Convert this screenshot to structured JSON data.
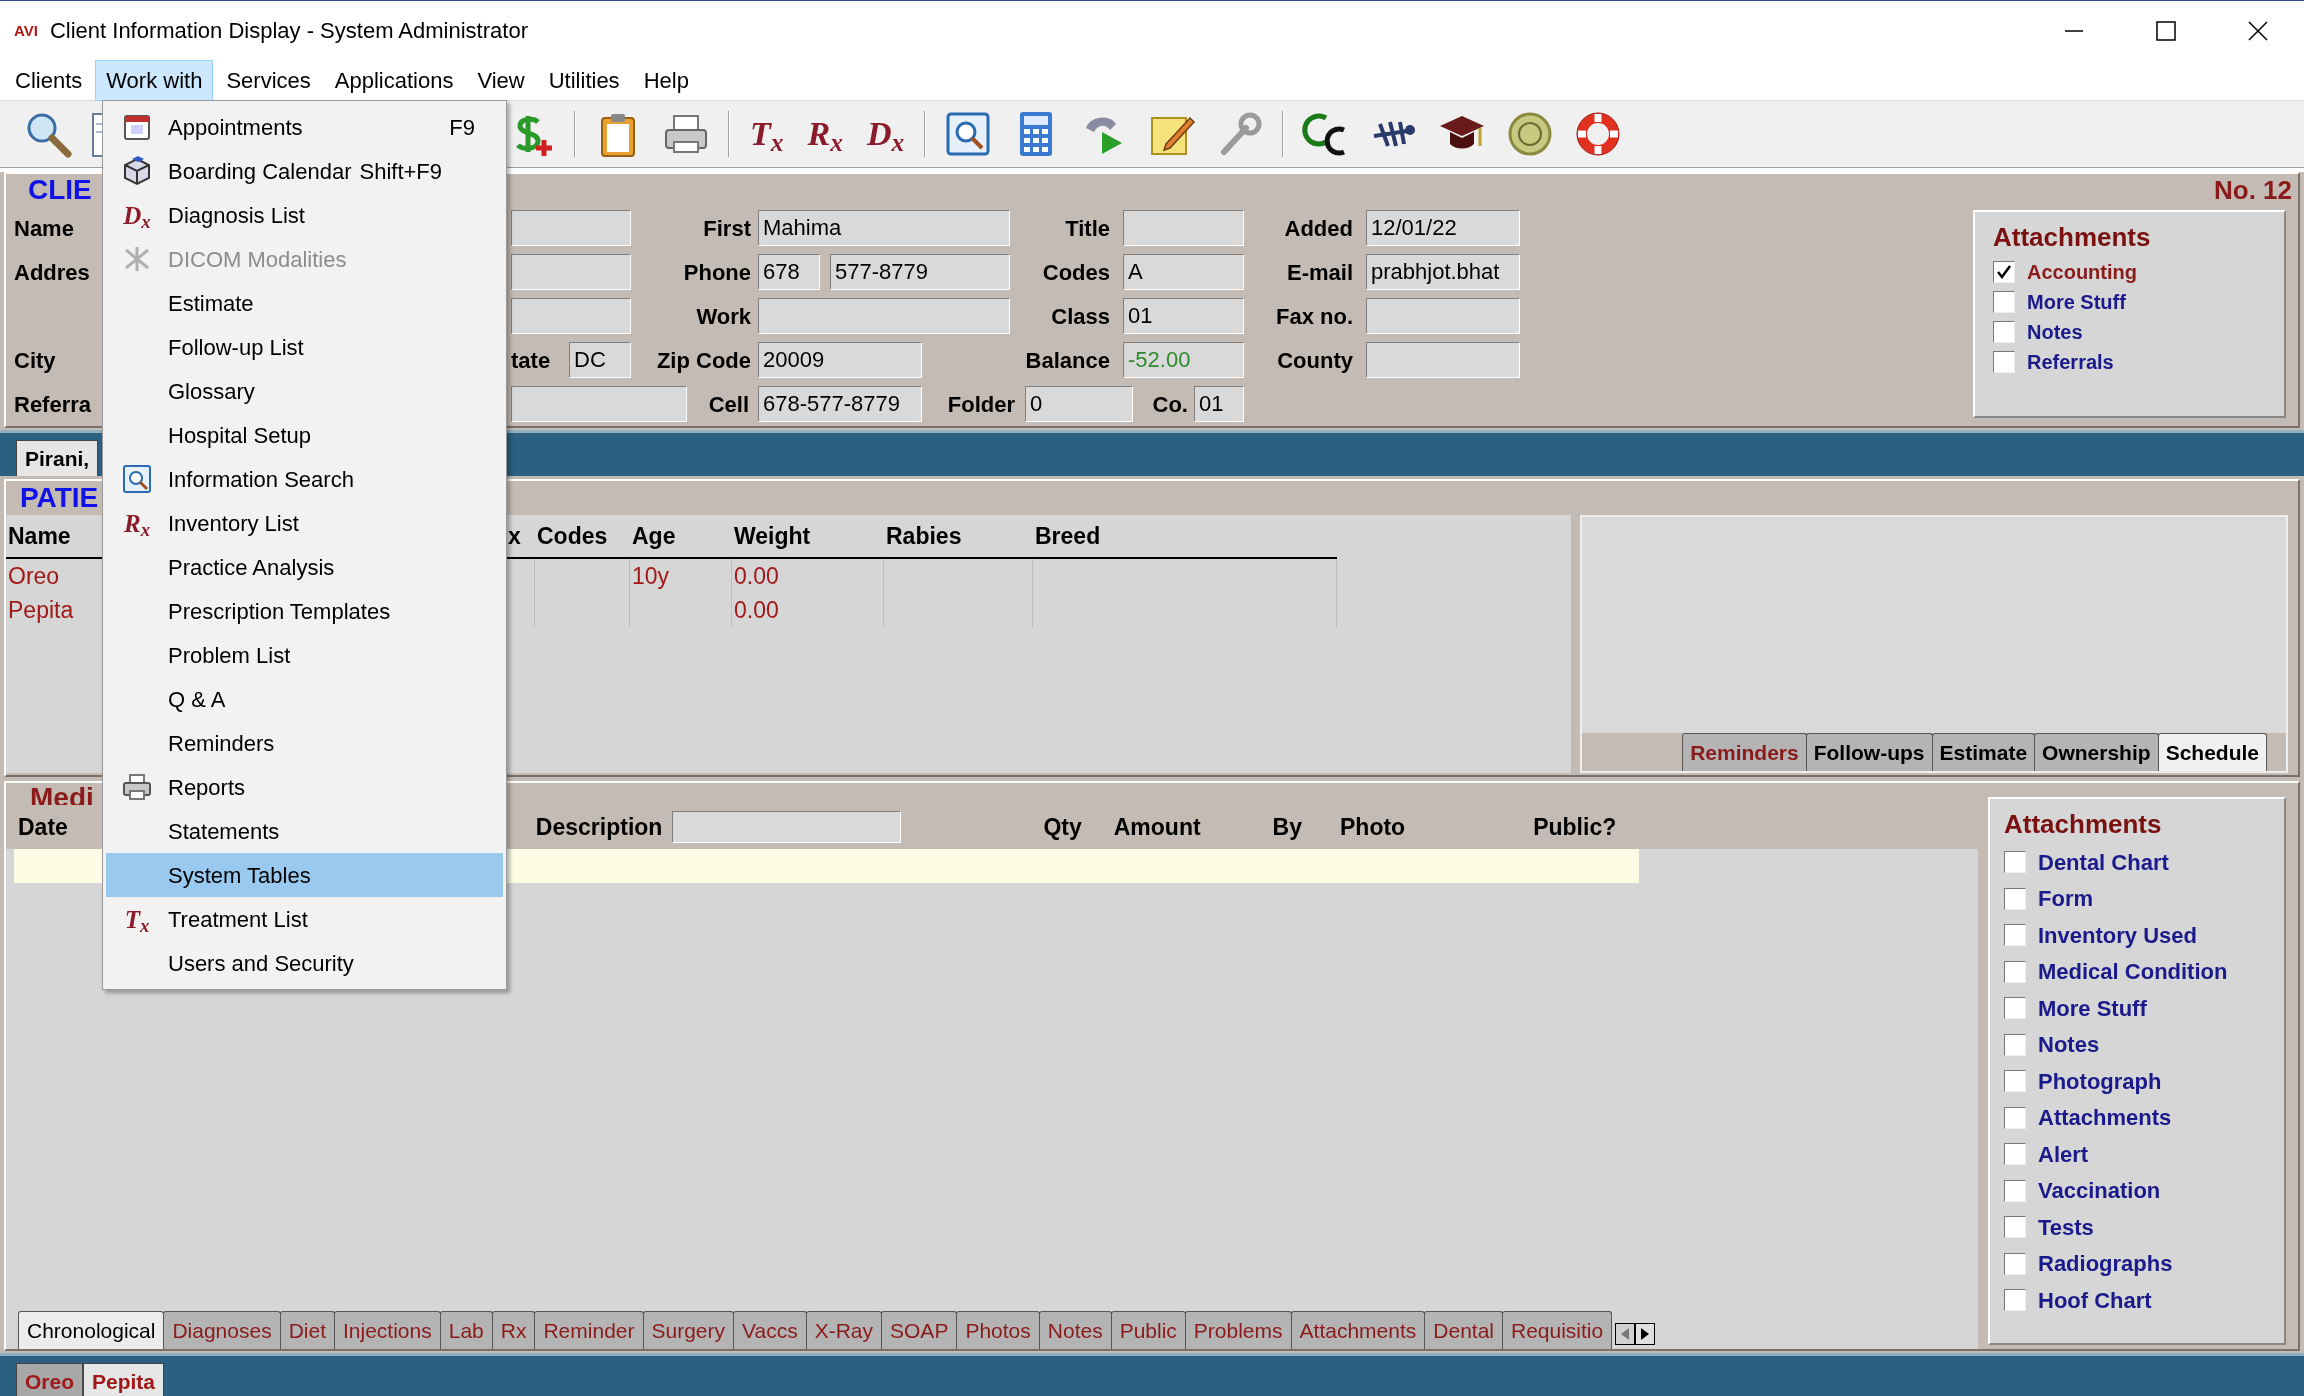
{
  "window": {
    "logo": "AVI",
    "title": "Client Information Display - System Administrator"
  },
  "menu_bar": [
    {
      "label": "Clients",
      "selected": false
    },
    {
      "label": "Work with",
      "selected": true
    },
    {
      "label": "Services",
      "selected": false
    },
    {
      "label": "Applications",
      "selected": false
    },
    {
      "label": "View",
      "selected": false
    },
    {
      "label": "Utilities",
      "selected": false
    },
    {
      "label": "Help",
      "selected": false
    }
  ],
  "toolbar": {
    "symbol_buttons": [
      "T$_{x}$",
      "R$_{x}$",
      "D$_{x}$"
    ]
  },
  "dropdown_menu": [
    {
      "label": "Appointments",
      "shortcut": "F9",
      "disabled": false,
      "selected": false
    },
    {
      "label": "Boarding Calendar",
      "shortcut": "Shift+F9",
      "disabled": false,
      "selected": false
    },
    {
      "label": "Diagnosis List",
      "symbol": "D$_{x}$",
      "disabled": false,
      "selected": false
    },
    {
      "label": "DICOM Modalities",
      "disabled": true,
      "selected": false
    },
    {
      "label": "Estimate",
      "disabled": false,
      "selected": false
    },
    {
      "label": "Follow-up List",
      "disabled": false,
      "selected": false
    },
    {
      "label": "Glossary",
      "disabled": false,
      "selected": false
    },
    {
      "label": "Hospital Setup",
      "disabled": false,
      "selected": false
    },
    {
      "label": "Information Search",
      "disabled": false,
      "selected": false
    },
    {
      "label": "Inventory List",
      "symbol": "R$_{x}$",
      "disabled": false,
      "selected": false
    },
    {
      "label": "Practice Analysis",
      "disabled": false,
      "selected": false
    },
    {
      "label": "Prescription Templates",
      "disabled": false,
      "selected": false
    },
    {
      "label": "Problem List",
      "disabled": false,
      "selected": false
    },
    {
      "label": "Q & A",
      "disabled": false,
      "selected": false
    },
    {
      "label": "Reminders",
      "disabled": false,
      "selected": false
    },
    {
      "label": "Reports",
      "disabled": false,
      "selected": false
    },
    {
      "label": "Statements",
      "disabled": false,
      "selected": false
    },
    {
      "label": "System Tables",
      "disabled": false,
      "selected": true
    },
    {
      "label": "Treatment List",
      "symbol": "T$_{x}$",
      "disabled": false,
      "selected": false
    },
    {
      "label": "Users and Security",
      "disabled": false,
      "selected": false
    }
  ],
  "client": {
    "title": "CLIE",
    "number": "No. 12",
    "form": [
      {
        "kind": "label",
        "text": "Name"
      },
      {
        "kind": "field"
      },
      {
        "kind": "label",
        "text": "First"
      },
      {
        "kind": "field",
        "value": "Mahima"
      },
      {
        "kind": "label",
        "text": "Title"
      },
      {
        "kind": "field"
      },
      {
        "kind": "label",
        "text": "Added"
      },
      {
        "kind": "field",
        "value": "12/01/22"
      },
      {
        "kind": "label",
        "text": "Addres"
      },
      {
        "kind": "field"
      },
      {
        "kind": "label",
        "text": "Phone"
      },
      {
        "kind": "field",
        "value": "678"
      },
      {
        "kind": "field",
        "value": "577-8779"
      },
      {
        "kind": "label",
        "text": "Codes"
      },
      {
        "kind": "field",
        "value": "A"
      },
      {
        "kind": "label",
        "text": "E-mail"
      },
      {
        "kind": "field",
        "value": "prabhjot.bhat"
      },
      {
        "kind": "field"
      },
      {
        "kind": "label",
        "text": "Work"
      },
      {
        "kind": "field"
      },
      {
        "kind": "label",
        "text": "Class"
      },
      {
        "kind": "field",
        "value": "01"
      },
      {
        "kind": "label",
        "text": "Fax no."
      },
      {
        "kind": "field"
      },
      {
        "kind": "label",
        "text": "City"
      },
      {
        "kind": "label",
        "text": "tate"
      },
      {
        "kind": "field",
        "value": "DC"
      },
      {
        "kind": "label",
        "text": "Zip Code"
      },
      {
        "kind": "field",
        "value": "20009"
      },
      {
        "kind": "label",
        "text": "Balance"
      },
      {
        "kind": "money-field",
        "value": "-52.00"
      },
      {
        "kind": "label",
        "text": "County"
      },
      {
        "kind": "field"
      },
      {
        "kind": "label",
        "text": "Referra"
      },
      {
        "kind": "field"
      },
      {
        "kind": "label",
        "text": "Cell"
      },
      {
        "kind": "field",
        "value": "678-577-8779"
      },
      {
        "kind": "label",
        "text": "Folder"
      },
      {
        "kind": "field",
        "value": "0"
      },
      {
        "kind": "label",
        "text": "Co."
      },
      {
        "kind": "field",
        "value": "01"
      }
    ],
    "attachments": {
      "title": "Attachments",
      "items": [
        {
          "label": "Accounting",
          "checked": true
        },
        {
          "label": "More Stuff",
          "checked": false
        },
        {
          "label": "Notes",
          "checked": false
        },
        {
          "label": "Referrals",
          "checked": false
        }
      ]
    }
  },
  "client_tabs": [
    {
      "label": "Pirani,",
      "selected": true
    }
  ],
  "patients": {
    "title": "PATIE",
    "columns": [
      "Name",
      "x",
      "Codes",
      "Age",
      "Weight",
      "Rabies",
      "Breed"
    ],
    "rows": [
      {
        "name": "Oreo",
        "age": "10y",
        "weight": "0.00"
      },
      {
        "name": "Pepita",
        "weight": "0.00"
      }
    ],
    "tabs": [
      {
        "label": "Reminders",
        "flagged": true,
        "selected": false
      },
      {
        "label": "Follow-ups",
        "flagged": false,
        "selected": false
      },
      {
        "label": "Estimate",
        "flagged": false,
        "selected": false
      },
      {
        "label": "Ownership",
        "flagged": false,
        "selected": false
      },
      {
        "label": "Schedule",
        "flagged": false,
        "selected": true
      }
    ]
  },
  "medical": {
    "title": "Medi",
    "columns": [
      "Date",
      "Description",
      "Qty",
      "Amount",
      "By",
      "Photo",
      "Public?"
    ],
    "tabs": [
      {
        "label": "Chronological",
        "selected": true
      },
      {
        "label": "Diagnoses",
        "selected": false
      },
      {
        "label": "Diet",
        "selected": false
      },
      {
        "label": "Injections",
        "selected": false
      },
      {
        "label": "Lab",
        "selected": false
      },
      {
        "label": "Rx",
        "selected": false
      },
      {
        "label": "Reminder",
        "selected": false
      },
      {
        "label": "Surgery",
        "selected": false
      },
      {
        "label": "Vaccs",
        "selected": false
      },
      {
        "label": "X-Ray",
        "selected": false
      },
      {
        "label": "SOAP",
        "selected": false
      },
      {
        "label": "Photos",
        "selected": false
      },
      {
        "label": "Notes",
        "selected": false
      },
      {
        "label": "Public",
        "selected": false
      },
      {
        "label": "Problems",
        "selected": false
      },
      {
        "label": "Attachments",
        "selected": false
      },
      {
        "label": "Dental",
        "selected": false
      },
      {
        "label": "Requisitio",
        "selected": false
      }
    ],
    "attachments": {
      "title": "Attachments",
      "items": [
        {
          "label": "Dental Chart",
          "checked": false
        },
        {
          "label": "Form",
          "checked": false
        },
        {
          "label": "Inventory Used",
          "checked": false
        },
        {
          "label": "Medical Condition",
          "checked": false
        },
        {
          "label": "More Stuff",
          "checked": false
        },
        {
          "label": "Notes",
          "checked": false
        },
        {
          "label": "Photograph",
          "checked": false
        },
        {
          "label": "Attachments",
          "checked": false
        },
        {
          "label": "Alert",
          "checked": false
        },
        {
          "label": "Vaccination",
          "checked": false
        },
        {
          "label": "Tests",
          "checked": false
        },
        {
          "label": "Radiographs",
          "checked": false
        },
        {
          "label": "Hoof Chart",
          "checked": false
        }
      ]
    }
  },
  "patient_tabs": [
    {
      "label": "Oreo",
      "selected": false
    },
    {
      "label": "Pepita",
      "selected": true
    }
  ]
}
